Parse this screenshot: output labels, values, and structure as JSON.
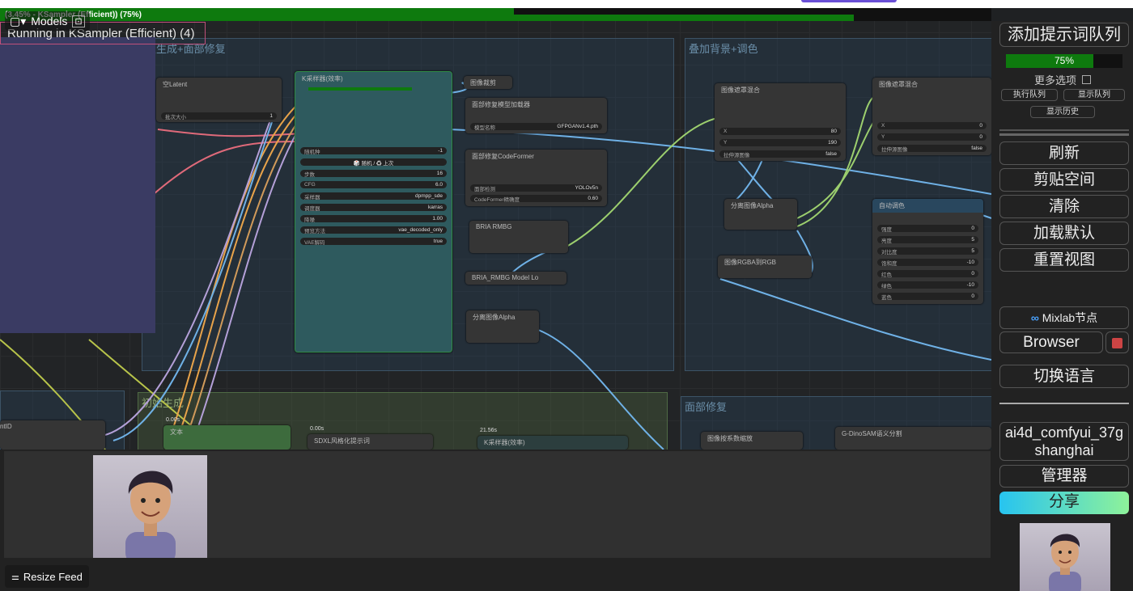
{
  "top_progress": {
    "text": "(3.45% - KSampler (Efficient)) (75%)"
  },
  "running": {
    "text": "Running in KSampler (Efficient) (4)"
  },
  "models_button": {
    "label": "Models"
  },
  "groups": [
    {
      "title": "次生成+面部修复"
    },
    {
      "title": "叠加背景+调色"
    },
    {
      "title": "初始生成"
    },
    {
      "title": "面部修复"
    }
  ],
  "nodes": {
    "empty_latent": {
      "title": "空Latent",
      "w1_label": "批次大小",
      "w1_value": "1"
    },
    "ksampler": {
      "title": "K采样器(效率)",
      "widgets": [
        {
          "label": "随机种",
          "value": "-1"
        },
        {
          "label": "",
          "value": "🎲 随机 / ♻ 上次"
        },
        {
          "label": "步数",
          "value": "16"
        },
        {
          "label": "CFG",
          "value": "6.0"
        },
        {
          "label": "采样器",
          "value": "dpmpp_sde"
        },
        {
          "label": "调度器",
          "value": "karras"
        },
        {
          "label": "降噪",
          "value": "1.00"
        },
        {
          "label": "预览方法",
          "value": "vae_decoded_only"
        },
        {
          "label": "VAE解码",
          "value": "true"
        }
      ]
    },
    "image_crop": {
      "title": "图像裁剪"
    },
    "face_loader": {
      "title": "面部修复模型加载器",
      "w1_label": "模型名称",
      "w1_value": "GFPGANv1.4.pth"
    },
    "codeformer": {
      "title": "面部修复CodeFormer",
      "w1_label": "面部检测",
      "w1_value": "YOLOv5n",
      "w2_label": "CodeFormer精确度",
      "w2_value": "0.60"
    },
    "bria": {
      "title": "BRIA RMBG"
    },
    "bria_loader": {
      "title": "BRIA_RMBG Model Lo"
    },
    "split_alpha1": {
      "title": "分离图像Alpha"
    },
    "mask_comp1": {
      "title": "图像遮罩混合",
      "x": "80",
      "y": "190",
      "stretch": "false",
      "x_label": "X",
      "y_label": "Y",
      "s_label": "拉伸源图像"
    },
    "mask_comp2": {
      "title": "图像遮罩混合",
      "x": "0",
      "y": "0",
      "stretch": "false",
      "x_label": "X",
      "y_label": "Y",
      "s_label": "拉伸源图像"
    },
    "split_alpha2": {
      "title": "分离图像Alpha"
    },
    "rgba_rgb": {
      "title": "图像RGBA到RGB"
    },
    "auto_color": {
      "title": "自动调色",
      "widgets": [
        {
          "label": "强度",
          "value": "0"
        },
        {
          "label": "亮度",
          "value": "5"
        },
        {
          "label": "对比度",
          "value": "5"
        },
        {
          "label": "饱和度",
          "value": "-10"
        },
        {
          "label": "红色",
          "value": "0"
        },
        {
          "label": "绿色",
          "value": "-10"
        },
        {
          "label": "蓝色",
          "value": "0"
        }
      ]
    },
    "left_node": {
      "title": "ntID"
    },
    "text_node": {
      "title": "文本",
      "time": "0.00s"
    },
    "sdxl_node": {
      "title": "SDXL风格化提示词",
      "time": "0.00s"
    },
    "ksampler2": {
      "title": "K采样器(效率)",
      "time": "21.56s"
    },
    "image_scale": {
      "title": "图像按系数缩放"
    },
    "dino": {
      "title": "G-DinoSAM语义分割"
    }
  },
  "sidebar": {
    "queue_button": "添加提示词队列",
    "progress": "75%",
    "progress_fraction": 0.75,
    "more_options": "更多选项",
    "exec_queue": "执行队列",
    "show_queue": "显示队列",
    "show_history": "显示历史",
    "refresh": "刷新",
    "clipspace": "剪贴空间",
    "clear": "清除",
    "load_default": "加载默认",
    "reset_view": "重置视图",
    "mixlab": "Mixlab节点",
    "browser": "Browser",
    "switch_lang": "切换语言",
    "workspace_line1": "ai4d_comfyui_37g",
    "workspace_line2": "shanghai",
    "manager": "管理器",
    "share": "分享"
  },
  "feed": {
    "resize_label": "Resize Feed"
  },
  "colors": {
    "accent_green": "#0e7a0e",
    "share_gradient_start": "#27c4f0",
    "share_gradient_end": "#8ef29a",
    "link_blue": "#6fb1e6",
    "link_green": "#9ccf6e",
    "link_orange": "#e8a34a",
    "link_red": "#e06a7a"
  }
}
